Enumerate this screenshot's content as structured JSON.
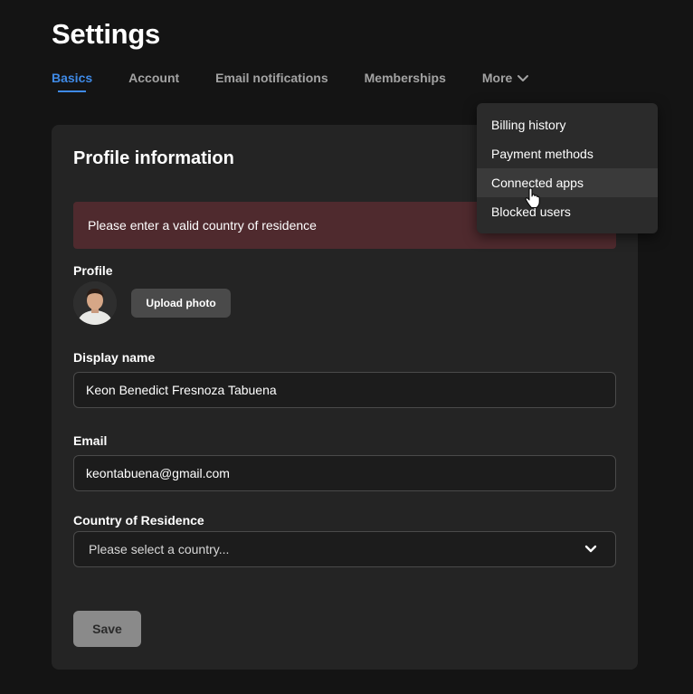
{
  "page": {
    "title": "Settings"
  },
  "tabs": [
    {
      "label": "Basics",
      "active": true
    },
    {
      "label": "Account"
    },
    {
      "label": "Email notifications"
    },
    {
      "label": "Memberships"
    },
    {
      "label": "More",
      "icon": "chevron-down-icon"
    }
  ],
  "more_menu": {
    "items": [
      {
        "label": "Billing history"
      },
      {
        "label": "Payment methods"
      },
      {
        "label": "Connected apps",
        "hovered": true
      },
      {
        "label": "Blocked users"
      }
    ]
  },
  "profile_card": {
    "title": "Profile information",
    "alert": "Please enter a valid country of residence",
    "profile_label": "Profile",
    "upload_label": "Upload photo",
    "display_name_label": "Display name",
    "display_name_value": "Keon Benedict Fresnoza Tabuena",
    "email_label": "Email",
    "email_value": "keontabuena@gmail.com",
    "country_label": "Country of Residence",
    "country_placeholder": "Please select a country...",
    "save_label": "Save"
  },
  "colors": {
    "background": "#141414",
    "card": "#242424",
    "accent": "#3f8ae6",
    "alert_bg": "#4f2a2e",
    "dropdown_bg": "#2b2b2b"
  }
}
